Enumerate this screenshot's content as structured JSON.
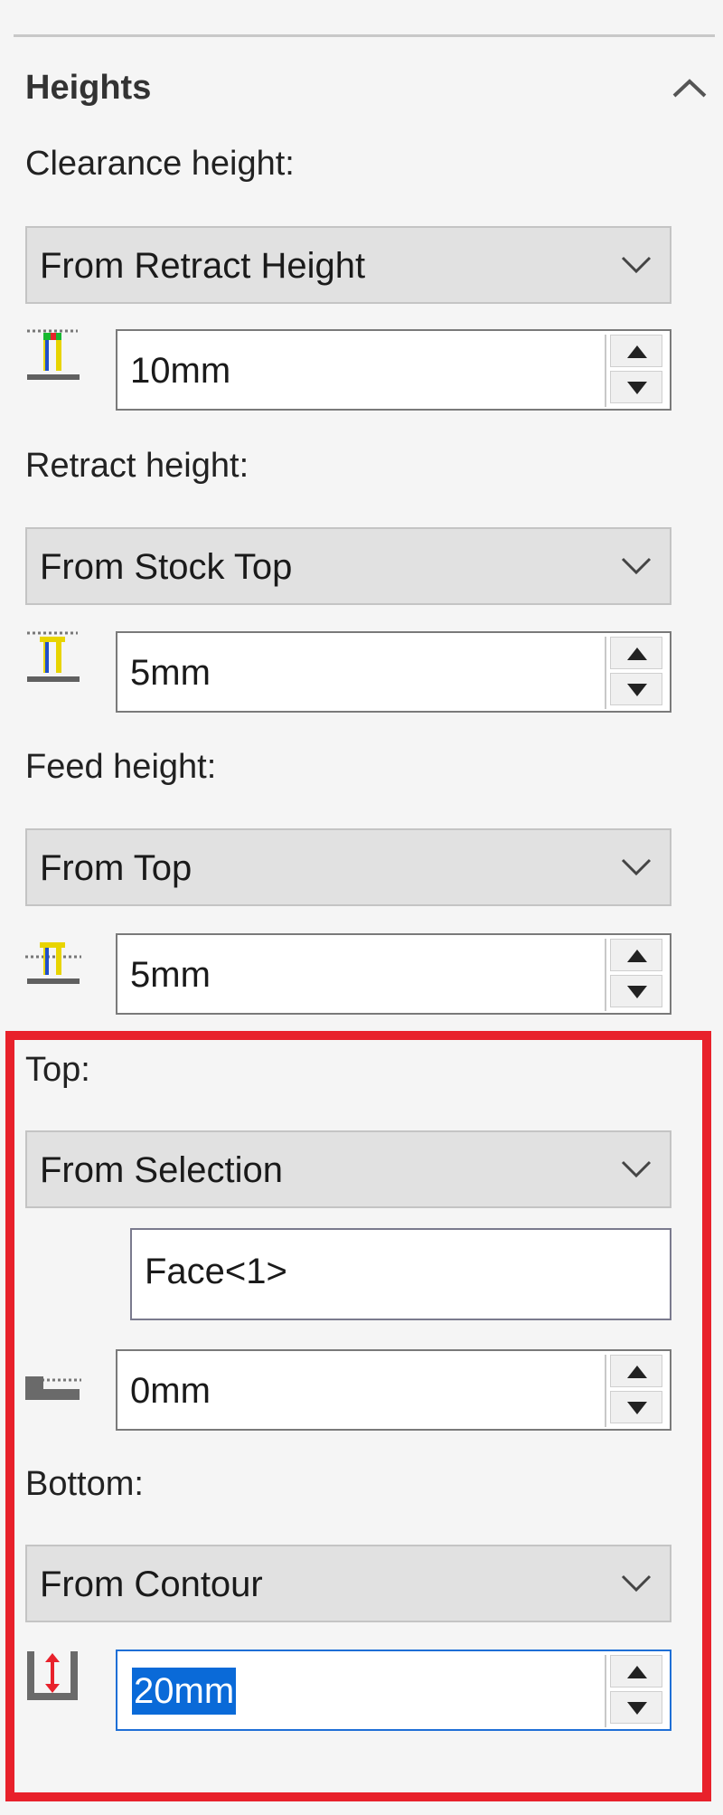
{
  "section": {
    "title": "Heights",
    "collapse_icon": "chevron-up-icon"
  },
  "clearance": {
    "label": "Clearance height:",
    "mode": "From Retract Height",
    "value": "10mm",
    "icon": "clearance-height-icon"
  },
  "retract": {
    "label": "Retract height:",
    "mode": "From Stock Top",
    "value": "5mm",
    "icon": "retract-height-icon"
  },
  "feed": {
    "label": "Feed height:",
    "mode": "From Top",
    "value": "5mm",
    "icon": "feed-height-icon"
  },
  "top": {
    "label": "Top:",
    "mode": "From Selection",
    "selection": "Face<1>",
    "value": "0mm",
    "icon": "top-offset-icon"
  },
  "bottom": {
    "label": "Bottom:",
    "mode": "From Contour",
    "value": "20mm",
    "icon": "bottom-depth-icon"
  },
  "colors": {
    "highlight_border": "#e8212b",
    "focus_border": "#1e6fd6",
    "selection_bg": "#0a6ad8"
  }
}
